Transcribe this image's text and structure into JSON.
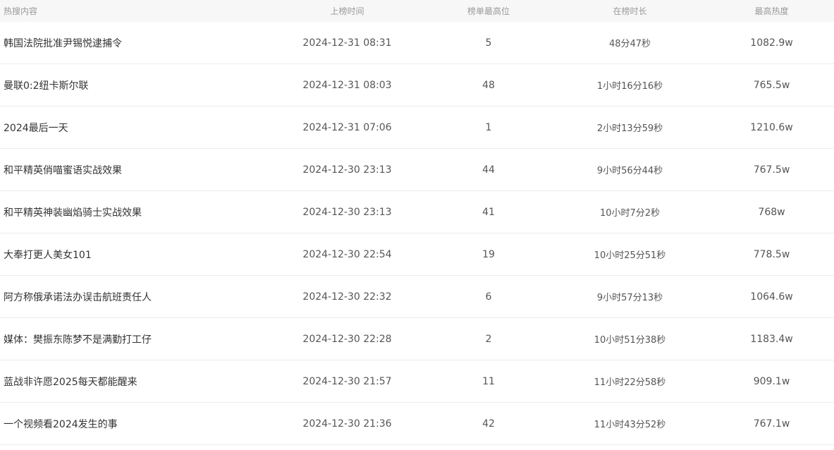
{
  "table": {
    "headers": [
      "热搜内容",
      "上榜时间",
      "榜单最高位",
      "在榜时长",
      "最高热度"
    ],
    "rows": [
      {
        "title": "韩国法院批准尹锡悦逮捕令",
        "time": "2024-12-31 08:31",
        "rank": "5",
        "duration": "48分47秒",
        "heat": "1082.9w"
      },
      {
        "title": "曼联0:2纽卡斯尔联",
        "time": "2024-12-31 08:03",
        "rank": "48",
        "duration": "1小时16分16秒",
        "heat": "765.5w"
      },
      {
        "title": "2024最后一天",
        "time": "2024-12-31 07:06",
        "rank": "1",
        "duration": "2小时13分59秒",
        "heat": "1210.6w"
      },
      {
        "title": "和平精英俏喵蜜语实战效果",
        "time": "2024-12-30 23:13",
        "rank": "44",
        "duration": "9小时56分44秒",
        "heat": "767.5w"
      },
      {
        "title": "和平精英神装幽焰骑士实战效果",
        "time": "2024-12-30 23:13",
        "rank": "41",
        "duration": "10小时7分2秒",
        "heat": "768w"
      },
      {
        "title": "大奉打更人美女101",
        "time": "2024-12-30 22:54",
        "rank": "19",
        "duration": "10小时25分51秒",
        "heat": "778.5w"
      },
      {
        "title": "阿方称俄承诺法办误击航班责任人",
        "time": "2024-12-30 22:32",
        "rank": "6",
        "duration": "9小时57分13秒",
        "heat": "1064.6w"
      },
      {
        "title": "媒体：樊振东陈梦不是满勤打工仔",
        "time": "2024-12-30 22:28",
        "rank": "2",
        "duration": "10小时51分38秒",
        "heat": "1183.4w"
      },
      {
        "title": "蓝战非许愿2025每天都能醒来",
        "time": "2024-12-30 21:57",
        "rank": "11",
        "duration": "11小时22分58秒",
        "heat": "909.1w"
      },
      {
        "title": "一个视频看2024发生的事",
        "time": "2024-12-30 21:36",
        "rank": "42",
        "duration": "11小时43分52秒",
        "heat": "767.1w"
      }
    ]
  }
}
